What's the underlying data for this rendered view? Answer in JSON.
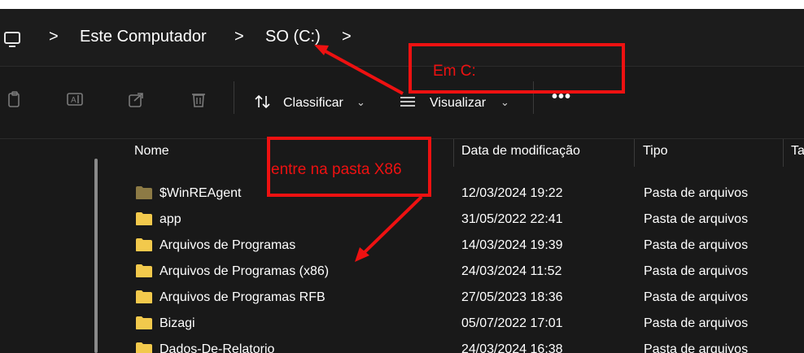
{
  "breadcrumb": {
    "items": [
      "Este Computador",
      "SO (C:)"
    ],
    "separator": ">"
  },
  "toolbar": {
    "sort_label": "Classificar",
    "view_label": "Visualizar",
    "more_label": "•••",
    "caret": "⌄"
  },
  "columns": {
    "name": "Nome",
    "modified": "Data de modificação",
    "type": "Tipo",
    "size": "Ta"
  },
  "rows": [
    {
      "name": "$WinREAgent",
      "date": "12/03/2024 19:22",
      "type": "Pasta de arquivos",
      "hidden": true
    },
    {
      "name": "app",
      "date": "31/05/2022 22:41",
      "type": "Pasta de arquivos",
      "hidden": false
    },
    {
      "name": "Arquivos de Programas",
      "date": "14/03/2024 19:39",
      "type": "Pasta de arquivos",
      "hidden": false
    },
    {
      "name": "Arquivos de Programas (x86)",
      "date": "24/03/2024 11:52",
      "type": "Pasta de arquivos",
      "hidden": false
    },
    {
      "name": "Arquivos de Programas RFB",
      "date": "27/05/2023 18:36",
      "type": "Pasta de arquivos",
      "hidden": false
    },
    {
      "name": "Bizagi",
      "date": "05/07/2022 17:01",
      "type": "Pasta de arquivos",
      "hidden": false
    },
    {
      "name": "Dados-De-Relatorio",
      "date": "24/03/2024 16:38",
      "type": "Pasta de arquivos",
      "hidden": false
    }
  ],
  "annotations": {
    "em_c": "Em C:",
    "x86": "entre na pasta X86"
  },
  "colors": {
    "annotation": "#ee1111",
    "folder": "#f2c94c",
    "folder_hidden": "#8c7a45",
    "background": "#191919"
  }
}
